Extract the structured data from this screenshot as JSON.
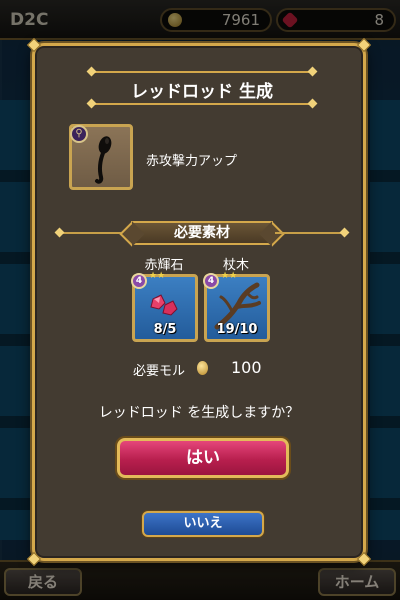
{
  "background": {
    "username": "D2C",
    "coins": "7961",
    "gems": "8",
    "back_label": "戻る",
    "home_label": "ホーム"
  },
  "dialog": {
    "title": "レッドロッド 生成",
    "item": {
      "icon": "red-rod-icon",
      "effect": "赤攻撃力アップ"
    },
    "materials_header": "必要素材",
    "materials": [
      {
        "name": "赤輝石",
        "icon": "red-gem-icon",
        "count": "8/5",
        "rank": "4"
      },
      {
        "name": "杖木",
        "icon": "wood-branch-icon",
        "count": "19/10",
        "rank": "4"
      }
    ],
    "cost_label": "必要モル",
    "cost_value": "100",
    "confirm_text": "レッドロッド を生成しますか？",
    "yes_label": "はい",
    "no_label": "いいえ"
  },
  "colors": {
    "frame_gold": "#d4a84b",
    "panel": "#433b31",
    "yes_button": "#c42a5a",
    "no_button": "#2a5aa8"
  }
}
